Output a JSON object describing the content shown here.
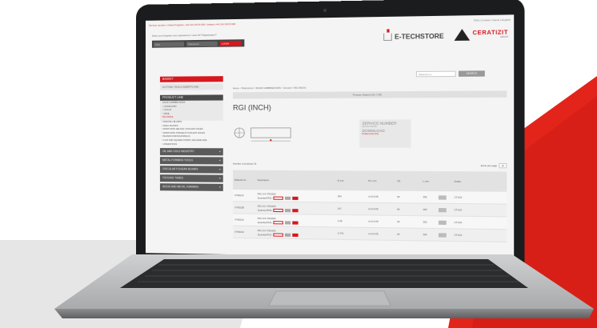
{
  "colors": {
    "accent_red": "#d6181e",
    "dark_bezel": "#1b1c1e",
    "screen_bg": "#f4f4f4"
  },
  "screen": {
    "topbar_left": "Service number: United Kingdom +44 114 243 8 000 / Ireland +44 114 243 8 000",
    "topbar_right": "FAQ | Contact | Home | English",
    "login_prompt": "Have you forgotten your password or user ID? Registration?",
    "login_user_placeholder": "User",
    "login_pass_placeholder": "Password",
    "login_button": "LOGIN",
    "estore_label": "E-TECHSTORE",
    "brand_name": "CERATIZIT",
    "brand_group": "GROUP",
    "search_placeholder": "Material no.",
    "search_button": "SEARCH",
    "breadcrumb": "Home > Shell prims > SOLID CARBIDE RODS > Ground > RGI (INCH)",
    "product_search_bar": "Product Search (On / Off)",
    "page_title": "RGI (INCH)",
    "service_title": "SERVICE NUMBER",
    "service_sub": "Service number",
    "download_title": "DOWNLOAD",
    "download_item": "Product info (1/1)",
    "num_products": "Number of products 16",
    "items_per_page_label": "Items per page",
    "items_per_page_value": "16",
    "sidebar": {
      "basket": "BASKET",
      "basket_box": "CUTTING TOOLS INSERTS AND",
      "product_line": "PRODUCT LINE",
      "sub": [
        "SOLID CARBIDE RODS",
        "> UNGROUND",
        "> Ground",
        "> RGIE",
        "RGI (INCH)"
      ],
      "tree": [
        "> END MILL BLANKS",
        "> DRILL BLANKS",
        "> RODS WITH HELICAL COOLANT HOLES",
        "> RODS WITH STRAIGHT COOLANT HOLES",
        "> BLANKS FOR DIAN DRILLS",
        "> FLAT AND SQUARE STRIPS, MACHINE SIZE",
        "> OPERATIONS"
      ],
      "grey": [
        "OIL AND GOLD INDUSTRY",
        "METAL FORMING TOOLS",
        "CIRCULAR FOUGAN BLANKS",
        "TOOLING TUBES",
        "WOOD AND METAL FORMING"
      ]
    },
    "table_headers": [
      "Material no.",
      "Description",
      "D mm",
      "Tol. mm",
      "Tol.",
      "L mm",
      "Grade"
    ],
    "rows": [
      {
        "mat": "V79621C",
        "desc": "RGI 1/4 I FD2000",
        "d": "254",
        "tol": "+0.0-0.05",
        "t": "h6",
        "l": "330",
        "grade": "CTU13"
      },
      {
        "mat": "V79623B",
        "desc": "RGI 1/2 I FD2000",
        "d": "317",
        "tol": "+0.0-0.05",
        "t": "h6",
        "l": "330",
        "grade": "CTU13"
      },
      {
        "mat": "V79621K",
        "desc": "RGI 1/4 I FD2000",
        "d": "4.35",
        "tol": "+0.0-0.05",
        "t": "h6",
        "l": "330",
        "grade": "CTU13"
      },
      {
        "mat": "V79621H",
        "desc": "RGI 1/4 I FD2000",
        "d": "3.775",
        "tol": "+0.0-0.05",
        "t": "h6",
        "l": "330",
        "grade": "CTU13"
      }
    ],
    "quantity_label": "Quantity/PCE"
  }
}
